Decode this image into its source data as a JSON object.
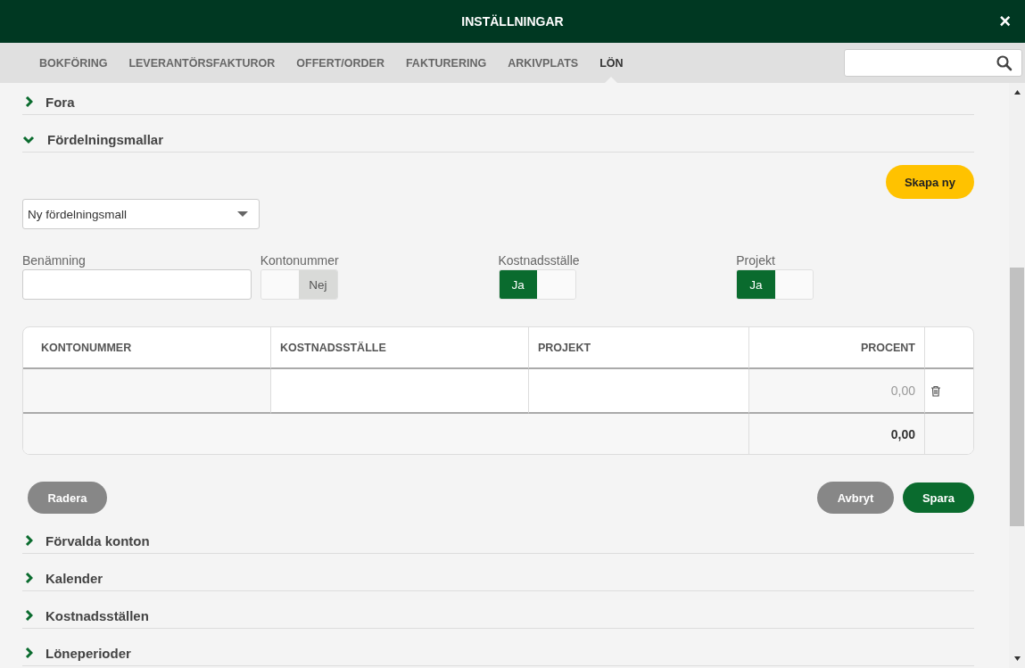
{
  "window": {
    "title": "INSTÄLLNINGAR",
    "close": "×"
  },
  "tabs": [
    {
      "label": "BOKFÖRING",
      "selected": false
    },
    {
      "label": "LEVERANTÖRSFAKTUROR",
      "selected": false
    },
    {
      "label": "OFFERT/ORDER",
      "selected": false
    },
    {
      "label": "FAKTURERING",
      "selected": false
    },
    {
      "label": "ARKIVPLATS",
      "selected": false
    },
    {
      "label": "LÖN",
      "selected": true
    }
  ],
  "sections": [
    {
      "title": "Fora",
      "expanded": false
    },
    {
      "title": "Fördelningsmallar",
      "expanded": true,
      "content": {
        "create_button": "Skapa ny",
        "template_select": {
          "value": "Ny fördelningsmall"
        },
        "fields": [
          {
            "kind": "text",
            "label": "Benämning"
          },
          {
            "kind": "toggle",
            "label": "Kontonummer",
            "on": false,
            "text": "Nej"
          },
          {
            "kind": "toggle",
            "label": "Kostnadsställe",
            "on": true,
            "text": "Ja"
          },
          {
            "kind": "toggle",
            "label": "Projekt",
            "on": true,
            "text": "Ja"
          }
        ],
        "table": {
          "columns": [
            "KONTONUMMER",
            "KOSTNADSSTÄLLE",
            "PROJEKT",
            "PROCENT"
          ],
          "rows": [
            {
              "cells": [
                "",
                "",
                "",
                "0,00"
              ]
            }
          ],
          "total": "0,00"
        },
        "buttons": [
          {
            "kind": "delete",
            "label": "Radera"
          },
          {
            "kind": "cancel",
            "label": "Avbryt"
          },
          {
            "kind": "save",
            "label": "Spara"
          }
        ]
      }
    },
    {
      "title": "Förvalda konton",
      "expanded": false
    },
    {
      "title": "Kalender",
      "expanded": false
    },
    {
      "title": "Kostnadsställen",
      "expanded": false
    },
    {
      "title": "Löneperioder",
      "expanded": false
    }
  ]
}
